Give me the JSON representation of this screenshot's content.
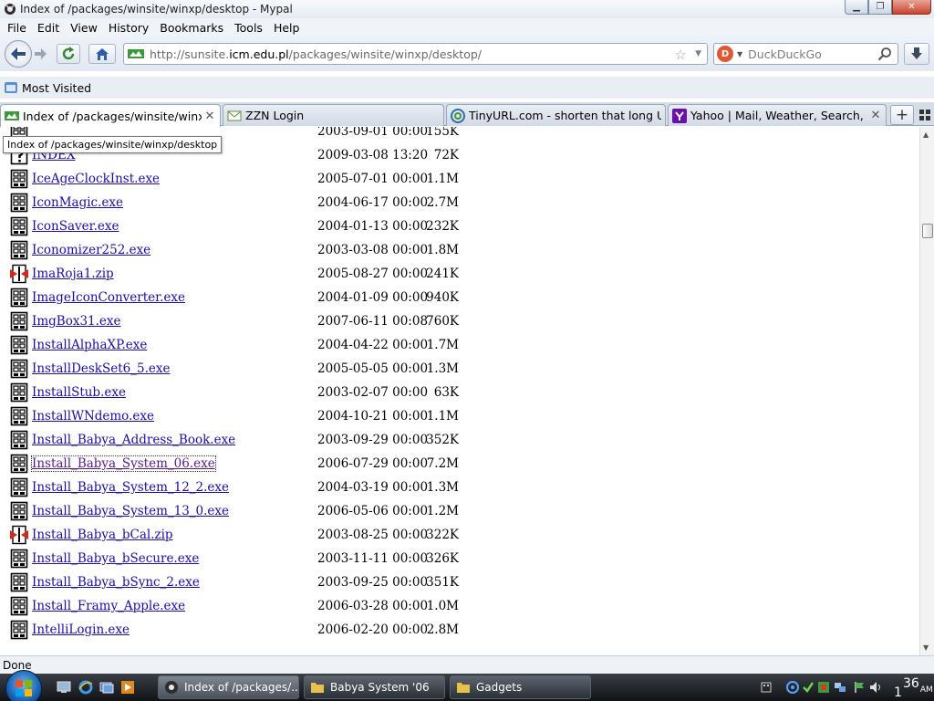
{
  "window": {
    "title": "Index of /packages/winsite/winxp/desktop - Mypal"
  },
  "menu": [
    "File",
    "Edit",
    "View",
    "History",
    "Bookmarks",
    "Tools",
    "Help"
  ],
  "nav": {
    "url_prefix": "http://sunsite.",
    "url_host": "icm.edu.pl",
    "url_path": "/packages/winsite/winxp/desktop/",
    "search_placeholder": "DuckDuckGo"
  },
  "bookmarks": [
    {
      "label": "Most Visited"
    }
  ],
  "tabs": [
    {
      "label": "Index of /packages/winsite/winxp/d...",
      "active": true
    },
    {
      "label": "ZZN Login",
      "active": false
    },
    {
      "label": "TinyURL.com - shorten that long U...",
      "active": false
    },
    {
      "label": "Yahoo | Mail, Weather, Search, Politi...",
      "active": false
    }
  ],
  "tooltip": "Index of /packages/winsite/winxp/desktop",
  "listing": [
    {
      "name": "",
      "date": "2003-09-01 00:00",
      "size": "155K",
      "icon": "exe"
    },
    {
      "name": "INDEX",
      "date": "2009-03-08 13:20",
      "size": "72K",
      "icon": "unknown"
    },
    {
      "name": "IceAgeClockInst.exe",
      "date": "2005-07-01 00:00",
      "size": "1.1M",
      "icon": "exe"
    },
    {
      "name": "IconMagic.exe",
      "date": "2004-06-17 00:00",
      "size": "2.7M",
      "icon": "exe"
    },
    {
      "name": "IconSaver.exe",
      "date": "2004-01-13 00:00",
      "size": "232K",
      "icon": "exe"
    },
    {
      "name": "Iconomizer252.exe",
      "date": "2003-03-08 00:00",
      "size": "1.8M",
      "icon": "exe"
    },
    {
      "name": "ImaRoja1.zip",
      "date": "2005-08-27 00:00",
      "size": "241K",
      "icon": "zip"
    },
    {
      "name": "ImageIconConverter.exe",
      "date": "2004-01-09 00:00",
      "size": "940K",
      "icon": "exe"
    },
    {
      "name": "ImgBox31.exe",
      "date": "2007-06-11 00:08",
      "size": "760K",
      "icon": "exe"
    },
    {
      "name": "InstallAlphaXP.exe",
      "date": "2004-04-22 00:00",
      "size": "1.7M",
      "icon": "exe"
    },
    {
      "name": "InstallDeskSet6_5.exe",
      "date": "2005-05-05 00:00",
      "size": "1.3M",
      "icon": "exe"
    },
    {
      "name": "InstallStub.exe",
      "date": "2003-02-07 00:00",
      "size": "63K",
      "icon": "exe"
    },
    {
      "name": "InstallWNdemo.exe",
      "date": "2004-10-21 00:00",
      "size": "1.1M",
      "icon": "exe"
    },
    {
      "name": "Install_Babya_Address_Book.exe",
      "date": "2003-09-29 00:00",
      "size": "352K",
      "icon": "exe"
    },
    {
      "name": "Install_Babya_System_06.exe",
      "date": "2006-07-29 00:00",
      "size": "7.2M",
      "icon": "exe"
    },
    {
      "name": "Install_Babya_System_12_2.exe",
      "date": "2004-03-19 00:00",
      "size": "1.3M",
      "icon": "exe"
    },
    {
      "name": "Install_Babya_System_13_0.exe",
      "date": "2006-05-06 00:00",
      "size": "1.2M",
      "icon": "exe"
    },
    {
      "name": "Install_Babya_bCal.zip",
      "date": "2003-08-25 00:00",
      "size": "322K",
      "icon": "zip"
    },
    {
      "name": "Install_Babya_bSecure.exe",
      "date": "2003-11-11 00:00",
      "size": "326K",
      "icon": "exe"
    },
    {
      "name": "Install_Babya_bSync_2.exe",
      "date": "2003-09-25 00:00",
      "size": "351K",
      "icon": "exe"
    },
    {
      "name": "Install_Framy_Apple.exe",
      "date": "2006-03-28 00:00",
      "size": "1.0M",
      "icon": "exe"
    },
    {
      "name": "IntelliLogin.exe",
      "date": "2006-02-20 00:00",
      "size": "2.8M",
      "icon": "exe"
    }
  ],
  "status": "Done",
  "taskbar": {
    "buttons": [
      {
        "label": "Index of /packages/...",
        "active": true
      },
      {
        "label": "Babya System '06",
        "active": false
      },
      {
        "label": "Gadgets",
        "active": false
      }
    ],
    "clock_minutes": "36",
    "clock_hour": "1",
    "clock_ampm": "AM"
  }
}
